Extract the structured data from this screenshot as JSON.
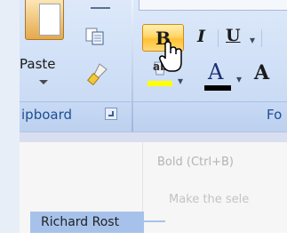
{
  "clipboard": {
    "paste_label": "Paste",
    "group_label": "ipboard"
  },
  "font": {
    "bold_glyph": "B",
    "italic_glyph": "I",
    "underline_glyph": "U",
    "highlight_text": "ab",
    "font_color_glyph": "A",
    "grow_font_glyph": "A",
    "group_label": "Fo",
    "dropdown_glyph": "▾",
    "highlight_color": "#ffff00",
    "font_color": "#000000"
  },
  "tooltip": {
    "title": "Bold (Ctrl+B)",
    "body": "Make the sele"
  },
  "watermark": {
    "text": "Richard Rost"
  }
}
